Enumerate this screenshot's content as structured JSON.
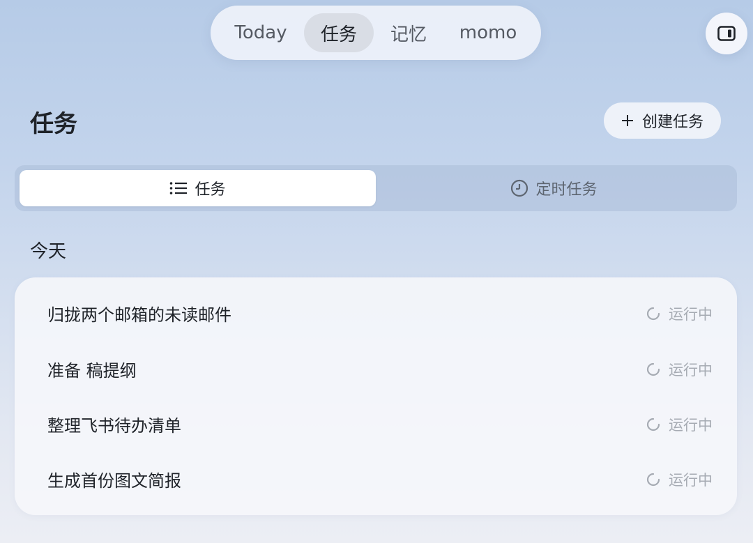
{
  "nav": {
    "tabs": [
      {
        "label": "Today"
      },
      {
        "label": "任务"
      },
      {
        "label": "记忆"
      },
      {
        "label": "momo"
      }
    ],
    "active_index": 1
  },
  "page": {
    "title": "任务",
    "create_button_label": "创建任务"
  },
  "segment": {
    "tasks_label": "任务",
    "scheduled_label": "定时任务",
    "active": "tasks"
  },
  "section": {
    "label": "今天"
  },
  "tasks": [
    {
      "title": "归拢两个邮箱的未读邮件",
      "status": "运行中"
    },
    {
      "title": "准备 稿提纲",
      "status": "运行中"
    },
    {
      "title": "整理飞书待办清单",
      "status": "运行中"
    },
    {
      "title": "生成首份图文简报",
      "status": "运行中"
    }
  ],
  "icons": {
    "sidebar_toggle": "sidebar-toggle-icon",
    "create": "plus-icon",
    "tasks": "list-icon",
    "scheduled": "clock-icon",
    "status": "loading-spinner-icon"
  }
}
